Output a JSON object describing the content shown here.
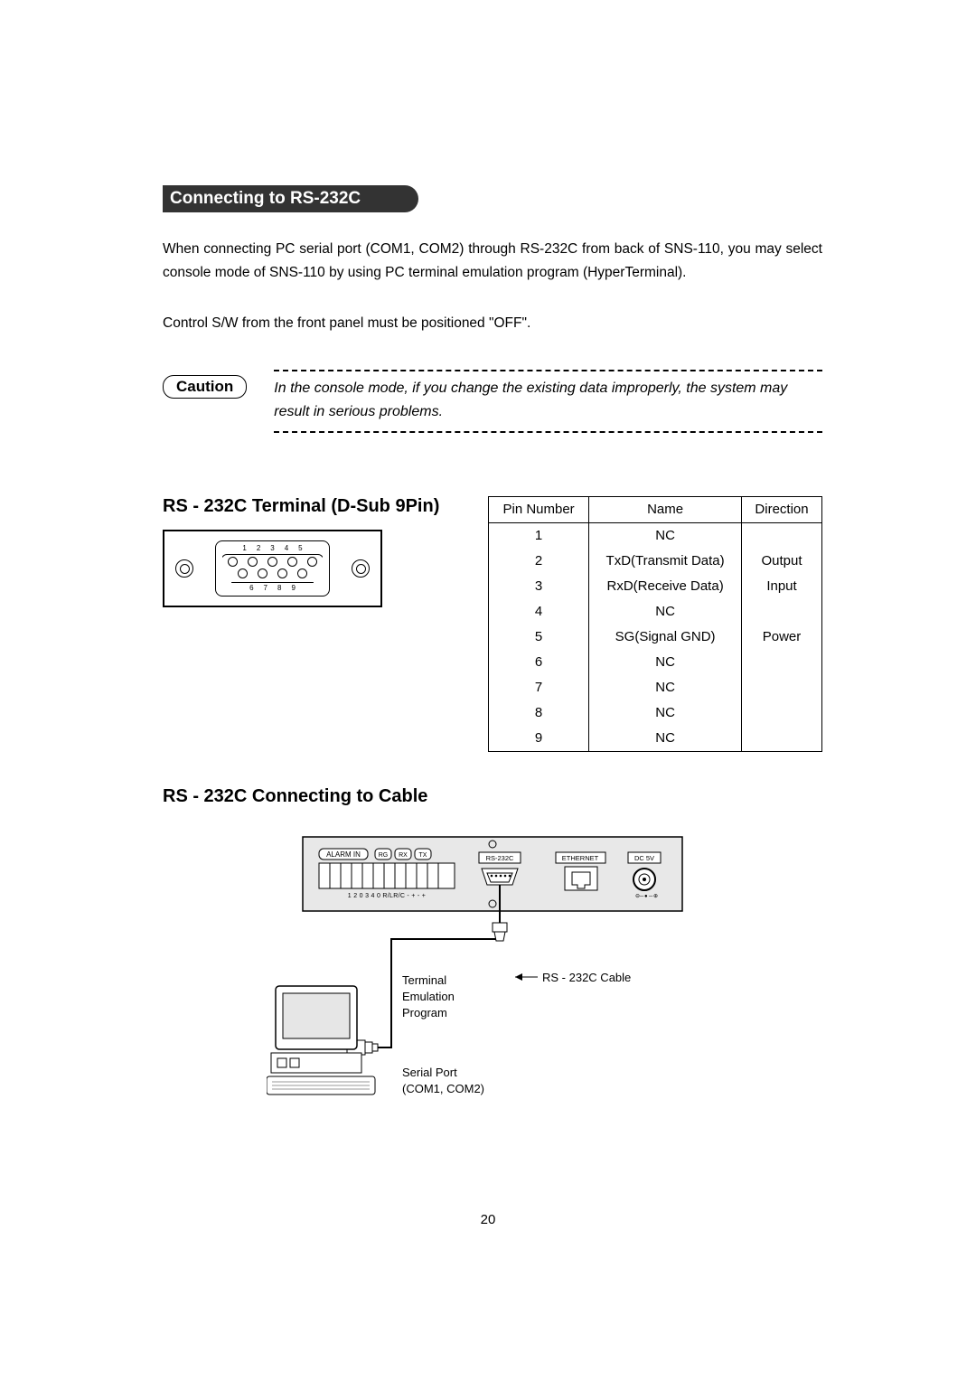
{
  "heading": "Connecting to RS-232C",
  "paragraph1": "When connecting PC serial port (COM1, COM2) through RS-232C from back of SNS-110, you may select console mode of SNS-110 by using PC terminal emulation program (HyperTerminal).",
  "paragraph2": "Control S/W  from the front panel must be positioned \"OFF\".",
  "caution_label": "Caution",
  "caution_text": "In the console mode, if you change the existing data improperly, the system may result in serious problems.",
  "terminal_title": "RS - 232C Terminal (D-Sub 9Pin)",
  "pin_table": {
    "headers": [
      "Pin Number",
      "Name",
      "Direction"
    ],
    "rows": [
      {
        "pin": "1",
        "name": "NC",
        "dir": ""
      },
      {
        "pin": "2",
        "name": "TxD(Transmit Data)",
        "dir": "Output"
      },
      {
        "pin": "3",
        "name": "RxD(Receive Data)",
        "dir": "Input"
      },
      {
        "pin": "4",
        "name": "NC",
        "dir": ""
      },
      {
        "pin": "5",
        "name": "SG(Signal GND)",
        "dir": "Power"
      },
      {
        "pin": "6",
        "name": "NC",
        "dir": ""
      },
      {
        "pin": "7",
        "name": "NC",
        "dir": ""
      },
      {
        "pin": "8",
        "name": "NC",
        "dir": ""
      },
      {
        "pin": "9",
        "name": "NC",
        "dir": ""
      }
    ]
  },
  "cable_title": "RS - 232C  Connecting to Cable",
  "diagram": {
    "device_labels": {
      "alarm_in": "ALARM IN",
      "rg": "RG",
      "rx": "RX",
      "tx": "TX",
      "terminals": "1   2   0   3   4   0  R/LR/C -   +   -   +",
      "rs232c": "RS-232C",
      "ethernet": "ETHERNET",
      "dc5v": "DC 5V"
    },
    "callout_cable": "RS - 232C Cable",
    "callout_terminal_emulation": "Terminal\nEmulation\nProgram",
    "callout_serial_port": "Serial Port\n(COM1, COM2)"
  },
  "page_number": "20",
  "dsub_pins_top": [
    "1",
    "2",
    "3",
    "4",
    "5"
  ],
  "dsub_pins_bottom": [
    "6",
    "7",
    "8",
    "9"
  ]
}
